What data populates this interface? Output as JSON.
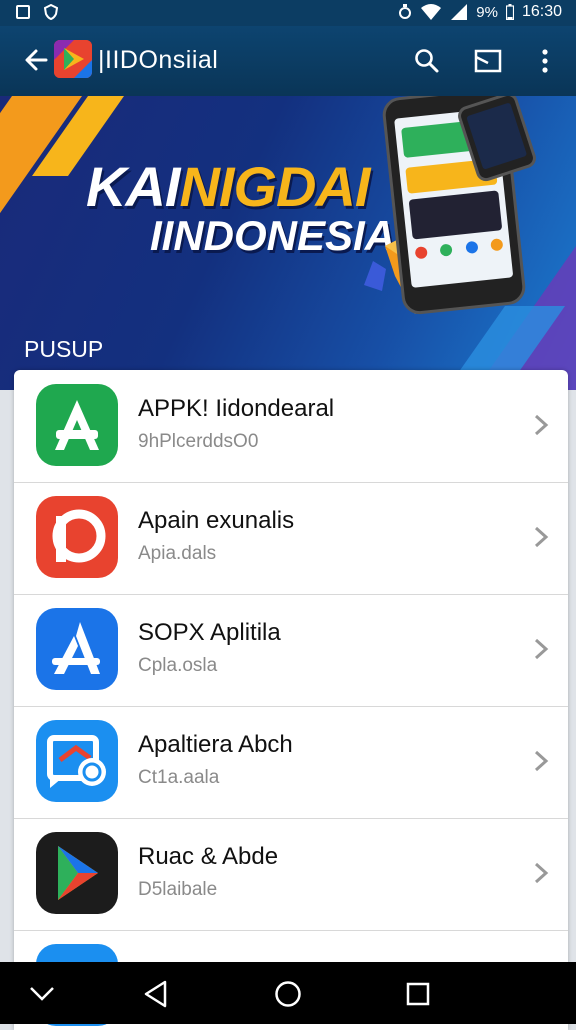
{
  "status_bar": {
    "left_icons": [
      "notification-icon",
      "shield-icon"
    ],
    "right_icons": [
      "alarm-icon",
      "wifi-icon",
      "signal-icon"
    ],
    "battery": "9%",
    "time": "16:30"
  },
  "app_bar": {
    "title": "|IIDOnsiial",
    "actions": [
      "search-icon",
      "cast-icon",
      "more-vert-icon"
    ]
  },
  "banner": {
    "title_white": "KAI",
    "title_yellow": "NIGDAI",
    "title_line2": "IINDONESIA"
  },
  "section_label": "PUSUP",
  "apps": [
    {
      "title": "APPK! Iidondearal",
      "subtitle": "9hPlcerddsO0",
      "icon": "green-a-icon",
      "color": "#1fa84f"
    },
    {
      "title": "Apain exunalis",
      "subtitle": "Apia.dals",
      "icon": "red-p-icon",
      "color": "#e8432f"
    },
    {
      "title": "SOPX Aplitila",
      "subtitle": "Cpla.osla",
      "icon": "blue-a-icon",
      "color": "#1b74e8"
    },
    {
      "title": "Apaltiera Abch",
      "subtitle": "Ct1a.aala",
      "icon": "blue-chart-icon",
      "color": "#1b8ff0"
    },
    {
      "title": "Ruac & Abde",
      "subtitle": "D5laibale",
      "icon": "play-store-icon",
      "color": "#1c1c1c"
    }
  ],
  "nav_bar": [
    "collapse-icon",
    "back-icon",
    "home-icon",
    "recents-icon"
  ]
}
